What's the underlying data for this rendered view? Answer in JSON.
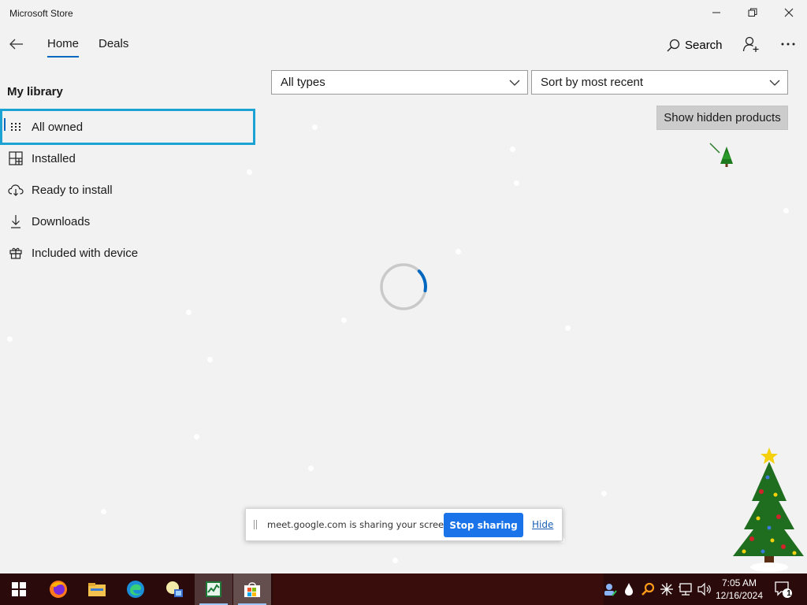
{
  "window": {
    "title": "Microsoft Store",
    "controls": [
      "minimize-icon",
      "restore-icon",
      "close-icon"
    ]
  },
  "nav": {
    "tabs": [
      {
        "label": "Home",
        "active": true
      },
      {
        "label": "Deals",
        "active": false
      }
    ],
    "search_label": "Search"
  },
  "sidebar": {
    "heading": "My library",
    "items": [
      {
        "label": "All owned",
        "icon": "grid-dots-icon",
        "selected": true
      },
      {
        "label": "Installed",
        "icon": "apps-grid-icon",
        "selected": false
      },
      {
        "label": "Ready to install",
        "icon": "cloud-download-icon",
        "selected": false
      },
      {
        "label": "Downloads",
        "icon": "download-arrow-icon",
        "selected": false
      },
      {
        "label": "Included with device",
        "icon": "gift-icon",
        "selected": false
      }
    ]
  },
  "filters": {
    "type_value": "All types",
    "sort_value": "Sort by most recent",
    "show_hidden_label": "Show hidden products"
  },
  "share_banner": {
    "text": "meet.google.com is sharing your screen.",
    "stop_label": "Stop sharing",
    "hide_label": "Hide"
  },
  "taskbar": {
    "apps": [
      "windows-start-icon",
      "firefox-icon",
      "file-explorer-icon",
      "edge-icon",
      "app-icon",
      "task-manager-icon",
      "store-icon"
    ],
    "time": "7:05 AM",
    "date": "12/16/2024",
    "notification_count": "1"
  },
  "colors": {
    "accent": "#0067c0",
    "focus_border": "#1ca3d4",
    "stop_button": "#1a73e8",
    "background": "#f2f2f2"
  }
}
